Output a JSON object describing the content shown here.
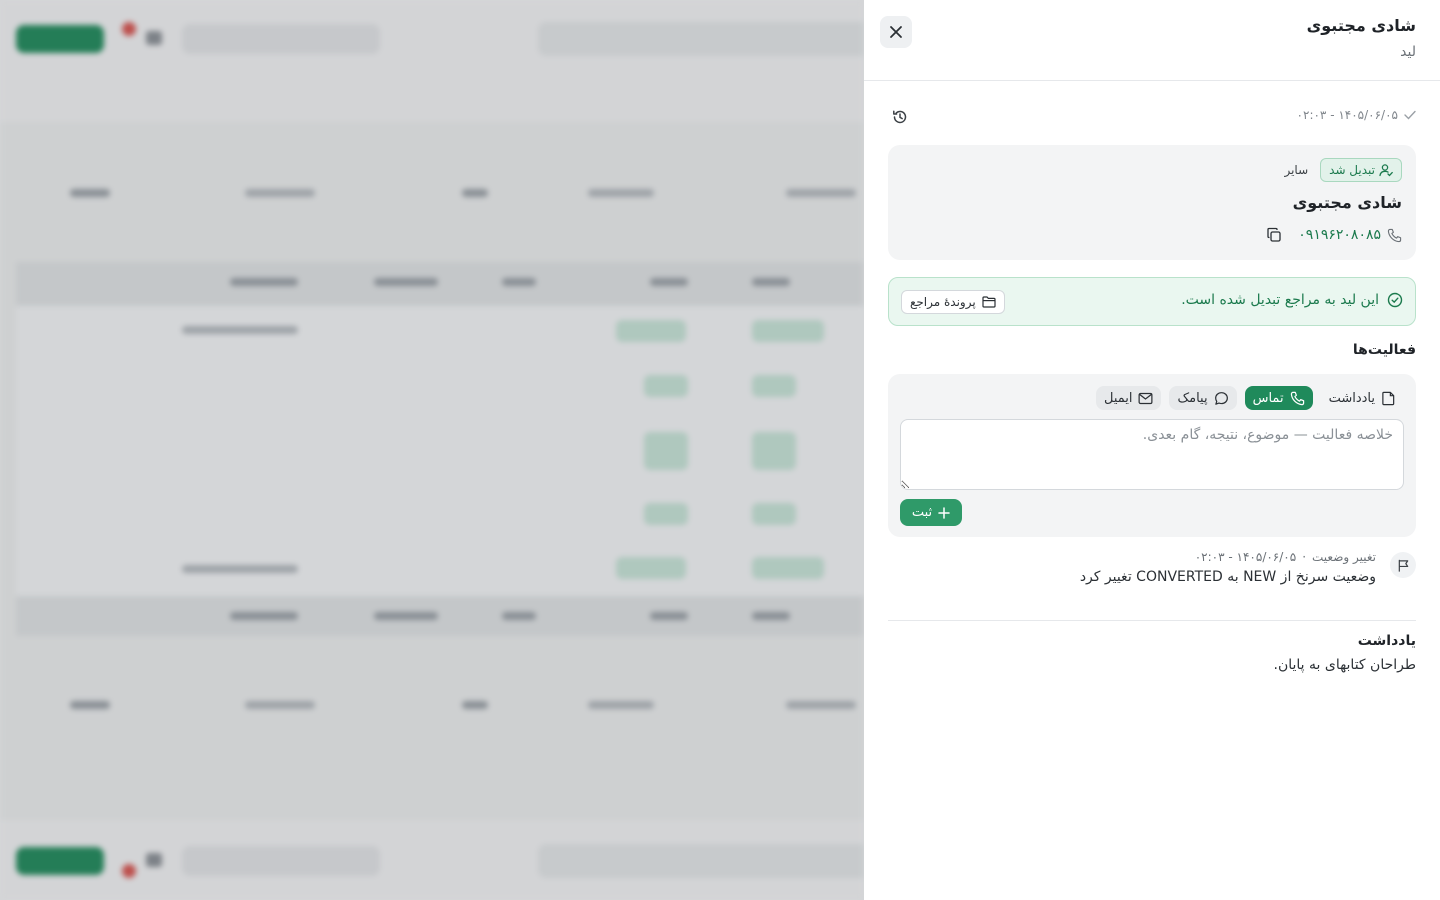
{
  "panel": {
    "title": "شادی مجتبوی",
    "subtitle": "لید",
    "updated_at": "۱۴۰۵/۰۶/۰۵ - ۰۲:۰۳"
  },
  "lead_card": {
    "status_badge": "تبدیل شد",
    "source_badge": "سایر",
    "name": "شادی مجتبوی",
    "phone": "۰۹۱۹۶۲۰۸۰۸۵"
  },
  "converted_alert": {
    "message": "این لید به مراجع تبدیل شده است.",
    "button_label": "پروندهٔ مراجع"
  },
  "activities": {
    "title": "فعالیت‌ها",
    "tabs": [
      {
        "label": "یادداشت",
        "icon": "note-icon",
        "active": false
      },
      {
        "label": "تماس",
        "icon": "phone-icon",
        "active": true
      },
      {
        "label": "پیامک",
        "icon": "chat-bubble-icon",
        "active": false
      },
      {
        "label": "ایمیل",
        "icon": "mail-icon",
        "active": false
      }
    ],
    "input_placeholder": "خلاصه فعالیت — موضوع، نتیجه، گام بعدی.",
    "submit_label": "ثبت"
  },
  "timeline": [
    {
      "type": "تغییر وضعیت",
      "separator": "·",
      "time": "۱۴۰۵/۰۶/۰۵ - ۰۲:۰۳",
      "description": "وضعیت سرنخ از NEW به CONVERTED تغییر کرد",
      "icon": "flag-icon"
    }
  ],
  "note": {
    "title": "یادداشت",
    "text": "طراحان کتابهای به پایان."
  },
  "colors": {
    "accent": "#1f8a5b",
    "accent_light": "#eaf7f0",
    "card_bg": "#f3f4f5"
  }
}
